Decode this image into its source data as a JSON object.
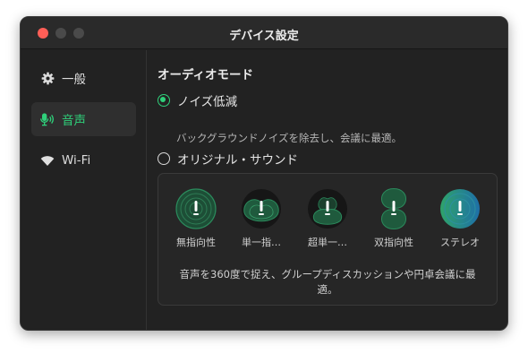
{
  "window": {
    "title": "デバイス設定"
  },
  "sidebar": {
    "items": [
      {
        "label": "一般",
        "icon": "gear-icon",
        "active": false
      },
      {
        "label": "音声",
        "icon": "mic-icon",
        "active": true
      },
      {
        "label": "Wi-Fi",
        "icon": "wifi-icon",
        "active": false
      }
    ]
  },
  "audio_mode": {
    "title": "オーディオモード",
    "options": [
      {
        "label": "ノイズ低減",
        "selected": true,
        "description": "バックグラウンドノイズを除去し、会議に最適。"
      },
      {
        "label": "オリジナル・サウンド",
        "selected": false
      }
    ],
    "patterns": [
      {
        "label": "無指向性",
        "icon": "omnidirectional-pattern-icon"
      },
      {
        "label": "単一指…",
        "icon": "cardioid-pattern-icon"
      },
      {
        "label": "超単一…",
        "icon": "supercardioid-pattern-icon"
      },
      {
        "label": "双指向性",
        "icon": "bidirectional-pattern-icon"
      },
      {
        "label": "ステレオ",
        "icon": "stereo-pattern-icon"
      }
    ],
    "pattern_description": "音声を360度で捉え、グループディスカッションや円卓会議に最適。"
  },
  "colors": {
    "accent": "#2fd07a",
    "background": "#222222",
    "close": "#ff5f57"
  }
}
